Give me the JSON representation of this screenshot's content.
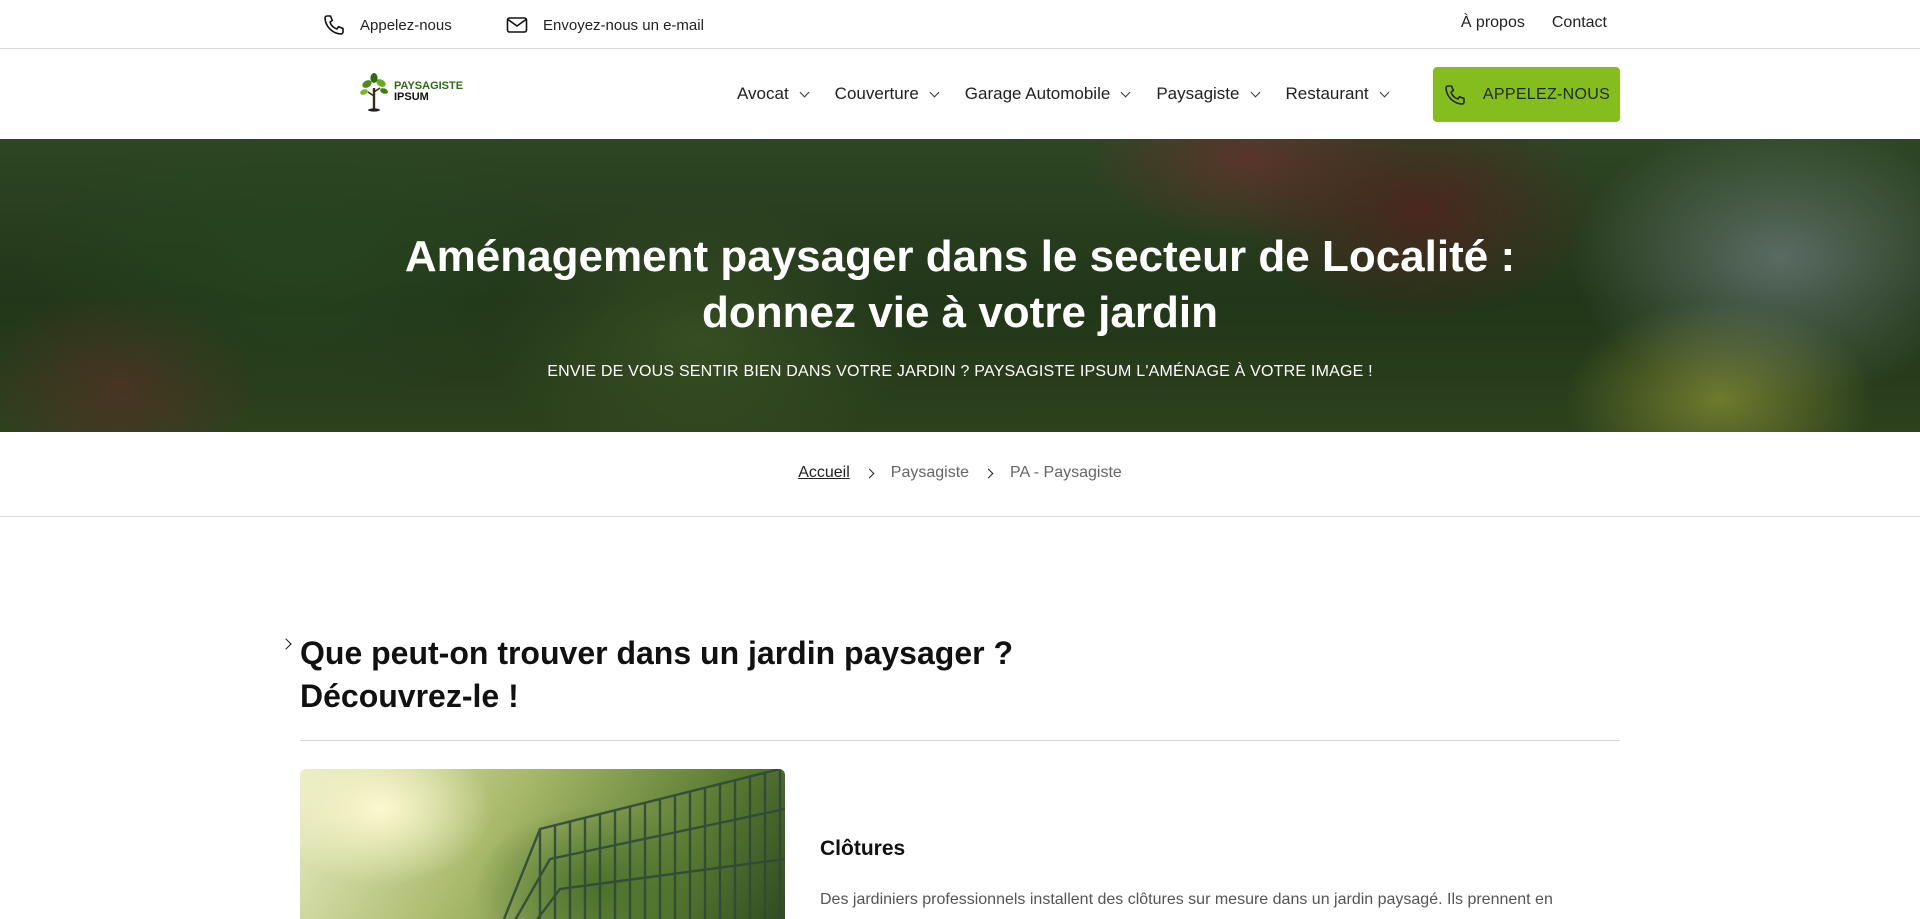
{
  "topbar": {
    "phone_label": "Appelez-nous",
    "email_label": "Envoyez-nous un e-mail",
    "links": [
      "À propos",
      "Contact"
    ]
  },
  "header": {
    "logo_line1": "PAYSAGISTE",
    "logo_line2": "IPSUM",
    "nav": [
      "Avocat",
      "Couverture",
      "Garage Automobile",
      "Paysagiste",
      "Restaurant"
    ],
    "cta_label": "APPELEZ-NOUS",
    "cta_color": "#86bd1e"
  },
  "hero": {
    "title": "Aménagement paysager dans le secteur de Localité : donnez vie à votre jardin",
    "subtitle": "ENVIE DE VOUS SENTIR BIEN DANS VOTRE JARDIN ? PAYSAGISTE IPSUM L'AMÉNAGE À VOTRE IMAGE !"
  },
  "breadcrumb": {
    "items": [
      "Accueil",
      "Paysagiste",
      "PA - Paysagiste"
    ]
  },
  "section": {
    "title": "Que peut-on trouver dans un jardin paysager ? Découvrez-le !",
    "feature": {
      "title": "Clôtures",
      "description": "Des jardiniers professionnels installent des clôtures sur mesure dans un jardin paysagé. Ils prennent en"
    }
  }
}
